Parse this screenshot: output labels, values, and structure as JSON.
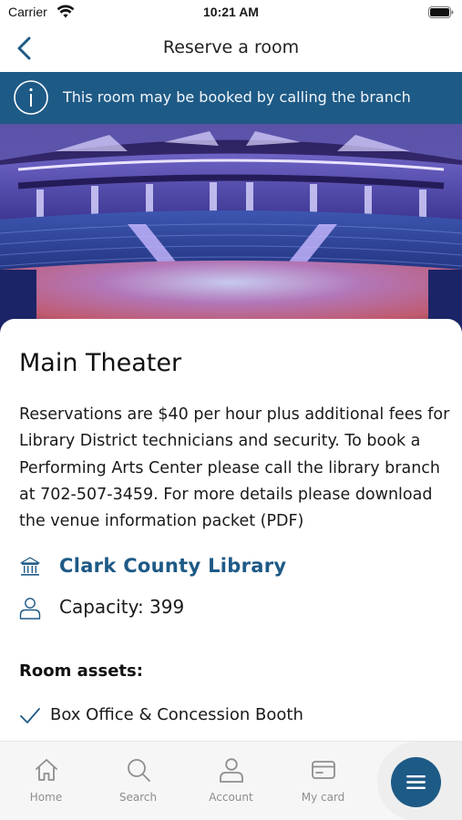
{
  "status_bar": {
    "carrier": "Carrier",
    "time": "10:21 AM",
    "icons": [
      "wifi-icon",
      "battery-icon"
    ]
  },
  "nav": {
    "title": "Reserve a room",
    "back_icon": "chevron-left-icon"
  },
  "banner": {
    "icon": "info-icon",
    "text": "This room may be booked by calling the branch",
    "background": "#1e5a86"
  },
  "hero": {
    "icon": "theater-photo"
  },
  "room": {
    "title": "Main Theater",
    "description": "Reservations are $40 per hour plus additional fees for Library District technicians and security. To book a Performing Arts Center please call the library branch at 702-507-3459. For more details please download the venue information packet (PDF)",
    "library": {
      "icon": "library-building-icon",
      "name": "Clark County Library"
    },
    "capacity": {
      "icon": "person-icon",
      "text": "Capacity: 399"
    },
    "assets": {
      "heading": "Room assets:",
      "items": [
        {
          "icon": "checkmark-icon",
          "label": "Box Office & Concession Booth"
        }
      ]
    }
  },
  "tab_bar": {
    "tabs": [
      {
        "icon": "home-icon",
        "label": "Home"
      },
      {
        "icon": "search-icon",
        "label": "Search"
      },
      {
        "icon": "account-icon",
        "label": "Account"
      },
      {
        "icon": "card-icon",
        "label": "My card"
      }
    ],
    "menu_icon": "menu-icon"
  },
  "colors": {
    "accent": "#1e5a86",
    "tab_inactive": "#8e8e8e"
  }
}
